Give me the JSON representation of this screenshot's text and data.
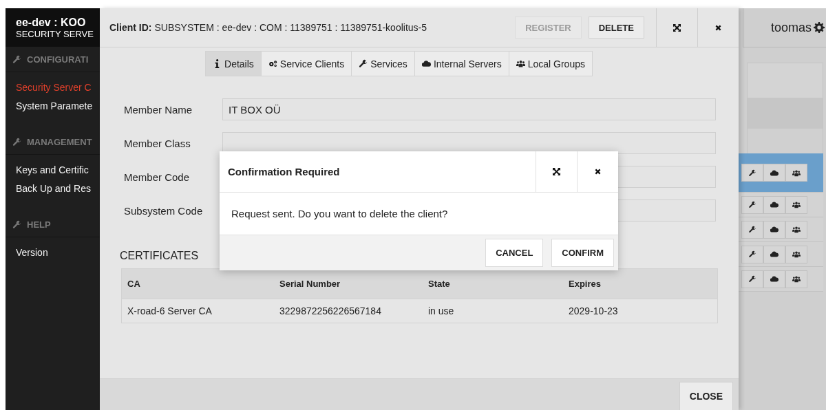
{
  "app": {
    "title": "ee-dev : KOO",
    "subtitle": "SECURITY SERVE"
  },
  "sidebar": {
    "sections": [
      {
        "heading": "CONFIGURATI",
        "items": [
          {
            "label": "Security Server C",
            "selected": true
          },
          {
            "label": "System Paramete",
            "selected": false
          }
        ]
      },
      {
        "heading": "MANAGEMENT",
        "items": [
          {
            "label": "Keys and Certific",
            "selected": false
          },
          {
            "label": "Back Up and Res",
            "selected": false
          }
        ]
      },
      {
        "heading": "HELP",
        "items": [
          {
            "label": "Version",
            "selected": false
          }
        ]
      }
    ]
  },
  "user": {
    "name": "toomas"
  },
  "background_rows": [
    {
      "selected": true
    },
    {
      "selected": false
    },
    {
      "selected": false
    },
    {
      "selected": false
    },
    {
      "selected": false
    }
  ],
  "client_dialog": {
    "title_label": "Client ID:",
    "title_value": "SUBSYSTEM : ee-dev : COM : 11389751 : 11389751-koolitus-5",
    "buttons": [
      {
        "label": "REGISTER",
        "disabled": true
      },
      {
        "label": "DELETE",
        "disabled": false
      }
    ],
    "tabs": [
      {
        "label": "Details",
        "kind": "info",
        "selected": true
      },
      {
        "label": "Service Clients",
        "kind": "gears",
        "selected": false
      },
      {
        "label": "Services",
        "kind": "wrench",
        "selected": false
      },
      {
        "label": "Internal Servers",
        "kind": "cloud",
        "selected": false
      },
      {
        "label": "Local Groups",
        "kind": "group",
        "selected": false
      }
    ],
    "fields": [
      {
        "label": "Member Name",
        "value": "IT BOX OÜ"
      },
      {
        "label": "Member Class"
      },
      {
        "label": "Member Code"
      },
      {
        "label": "Subsystem Code"
      }
    ],
    "certificates": {
      "heading": "CERTIFICATES",
      "columns": [
        "CA",
        "Serial Number",
        "State",
        "Expires"
      ],
      "rows": [
        [
          "X-road-6 Server CA",
          "3229872256226567184",
          "in use",
          "2029-10-23"
        ]
      ]
    },
    "close_button": "CLOSE"
  },
  "confirmation": {
    "title": "Confirmation Required",
    "message": "Request sent. Do you want to delete the client?",
    "buttons": [
      "CANCEL",
      "CONFIRM"
    ]
  }
}
